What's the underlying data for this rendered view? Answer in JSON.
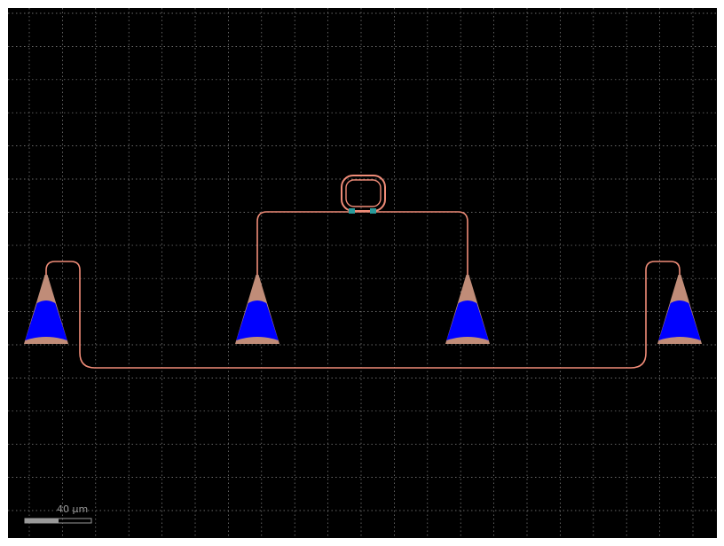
{
  "layout_view": {
    "background_color": "#000000",
    "grid": true,
    "grid_color": "#8a8a8a",
    "waveguide_color": "#f08c78",
    "grating_taper_color": "#c08c78",
    "grating_teeth_color": "#0000ff",
    "via_color": "#2a9a9a",
    "scale_bar": {
      "label": "40 µm",
      "color": "#9a9a9a"
    }
  }
}
